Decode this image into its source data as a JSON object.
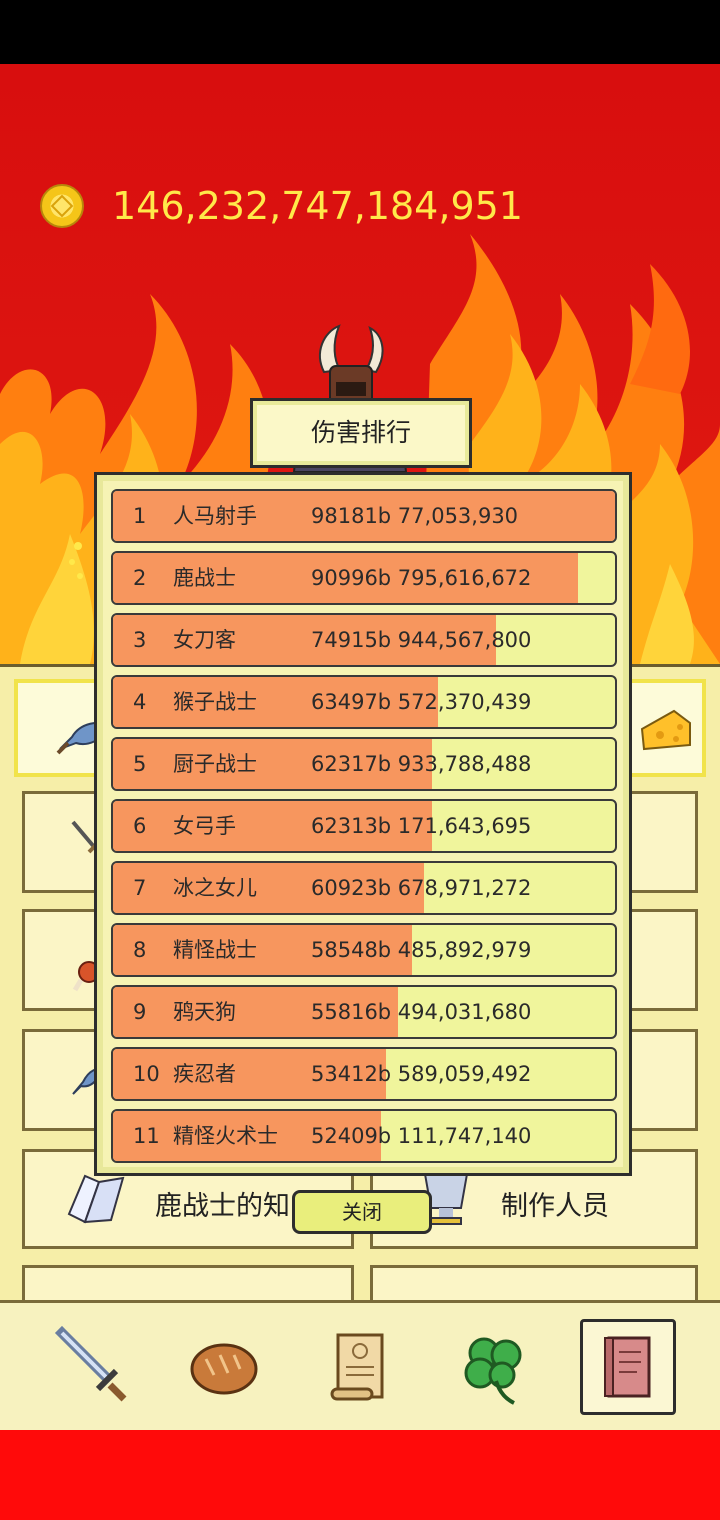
{
  "hud": {
    "gold_amount": "146,232,747,184,951"
  },
  "ranking": {
    "title": "伤害排行",
    "close_label": "关闭",
    "rows": [
      {
        "rank": "1",
        "name": "人马射手",
        "value": "98181b 77,053,930",
        "fill": 1.0
      },
      {
        "rank": "2",
        "name": "鹿战士",
        "value": "90996b 795,616,672",
        "fill": 0.927
      },
      {
        "rank": "3",
        "name": "女刀客",
        "value": "74915b 944,567,800",
        "fill": 0.763
      },
      {
        "rank": "4",
        "name": "猴子战士",
        "value": "63497b 572,370,439",
        "fill": 0.647
      },
      {
        "rank": "5",
        "name": "厨子战士",
        "value": "62317b 933,788,488",
        "fill": 0.635
      },
      {
        "rank": "6",
        "name": "女弓手",
        "value": "62313b 171,643,695",
        "fill": 0.635
      },
      {
        "rank": "7",
        "name": "冰之女儿",
        "value": "60923b 678,971,272",
        "fill": 0.62
      },
      {
        "rank": "8",
        "name": "精怪战士",
        "value": "58548b 485,892,979",
        "fill": 0.596
      },
      {
        "rank": "9",
        "name": "鸦天狗",
        "value": "55816b 494,031,680",
        "fill": 0.568
      },
      {
        "rank": "10",
        "name": "疾忍者",
        "value": "53412b 589,059,492",
        "fill": 0.544
      },
      {
        "rank": "11",
        "name": "精怪火术士",
        "value": "52409b 111,747,140",
        "fill": 0.534
      }
    ]
  },
  "menu": {
    "knowledge_label": "鹿战士的知",
    "credits_label": "制作人员"
  },
  "colors": {
    "bar_fill": "#f7965e",
    "bar_bg": "#f0f59c",
    "gold_text": "#ffe94a"
  }
}
